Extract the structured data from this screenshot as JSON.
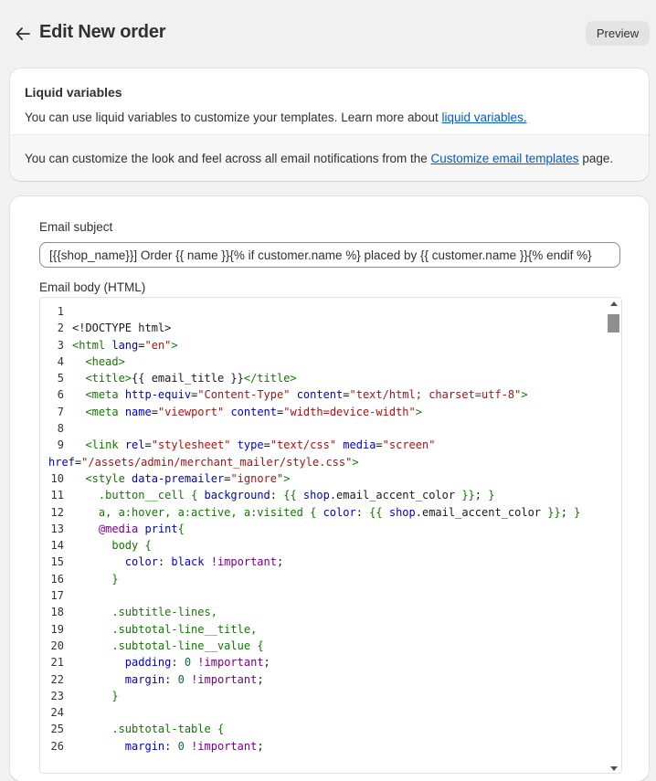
{
  "header": {
    "title": "Edit New order",
    "preview_label": "Preview"
  },
  "liquid": {
    "heading": "Liquid variables",
    "text": "You can use liquid variables to customize your templates. Learn more about ",
    "link": "liquid variables.",
    "sub_text": "You can customize the look and feel across all email notifications from the ",
    "sub_link": "Customize email templates",
    "sub_tail": " page."
  },
  "email": {
    "subject_label": "Email subject",
    "subject_value": "[{{shop_name}}] Order {{ name }}{% if customer.name %} placed by {{ customer.name }}{% endif %}",
    "body_label": "Email body (HTML)"
  },
  "code": {
    "line_numbers": [
      "1",
      "2",
      "3",
      "4",
      "5",
      "6",
      "7",
      "8",
      "9",
      "10",
      "11",
      "12",
      "13",
      "14",
      "15",
      "16",
      "17",
      "18",
      "19",
      "20",
      "21",
      "22",
      "23",
      "24",
      "25",
      "26"
    ]
  },
  "icons": {
    "back": "arrow-left-icon",
    "scroll_up": "triangle-up-icon",
    "scroll_down": "triangle-down-icon"
  }
}
